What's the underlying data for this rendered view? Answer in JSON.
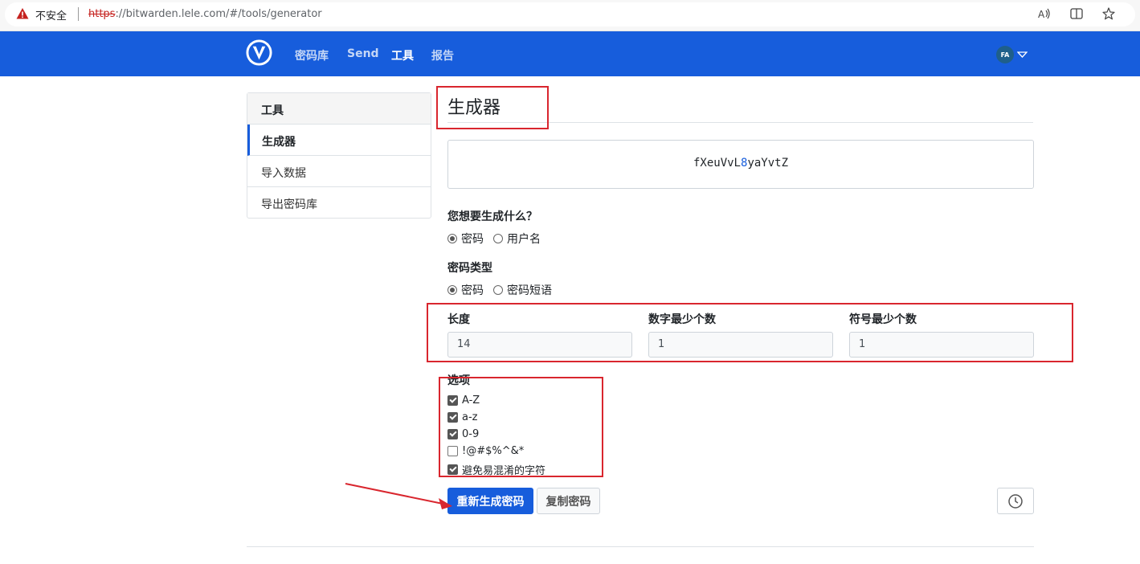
{
  "browser": {
    "security_label": "不安全",
    "url_scheme": "https",
    "url_rest": "://bitwarden.lele.com/#/tools/generator",
    "read_aloud_icon_text": "A⁾"
  },
  "navbar": {
    "links": [
      "密码库",
      "Send",
      "工具",
      "报告"
    ],
    "active_link": "工具",
    "avatar_initials": "FA"
  },
  "sidebar": {
    "header": "工具",
    "items": [
      {
        "label": "生成器",
        "active": true
      },
      {
        "label": "导入数据",
        "active": false
      },
      {
        "label": "导出密码库",
        "active": false
      }
    ]
  },
  "main": {
    "title": "生成器",
    "generated_password_prefix": "fXeuVvL",
    "generated_password_digit": "8",
    "generated_password_suffix": "yaYvtZ",
    "what_to_generate": {
      "label": "您想要生成什么？",
      "options": [
        "密码",
        "用户名"
      ],
      "selected": "密码"
    },
    "password_type": {
      "label": "密码类型",
      "options": [
        "密码",
        "密码短语"
      ],
      "selected": "密码"
    },
    "fields": {
      "length": {
        "label": "长度",
        "value": "14"
      },
      "min_numbers": {
        "label": "数字最少个数",
        "value": "1"
      },
      "min_special": {
        "label": "符号最少个数",
        "value": "1"
      }
    },
    "options": {
      "label": "选项",
      "items": [
        {
          "label": "A-Z",
          "checked": true
        },
        {
          "label": "a-z",
          "checked": true
        },
        {
          "label": "0-9",
          "checked": true
        },
        {
          "label": "!@#$%^&*",
          "checked": false
        },
        {
          "label": "避免易混淆的字符",
          "checked": true
        }
      ]
    },
    "buttons": {
      "regenerate": "重新生成密码",
      "copy": "复制密码"
    }
  },
  "colors": {
    "brand_blue": "#175ddc",
    "annotation_red": "#d9262e"
  }
}
